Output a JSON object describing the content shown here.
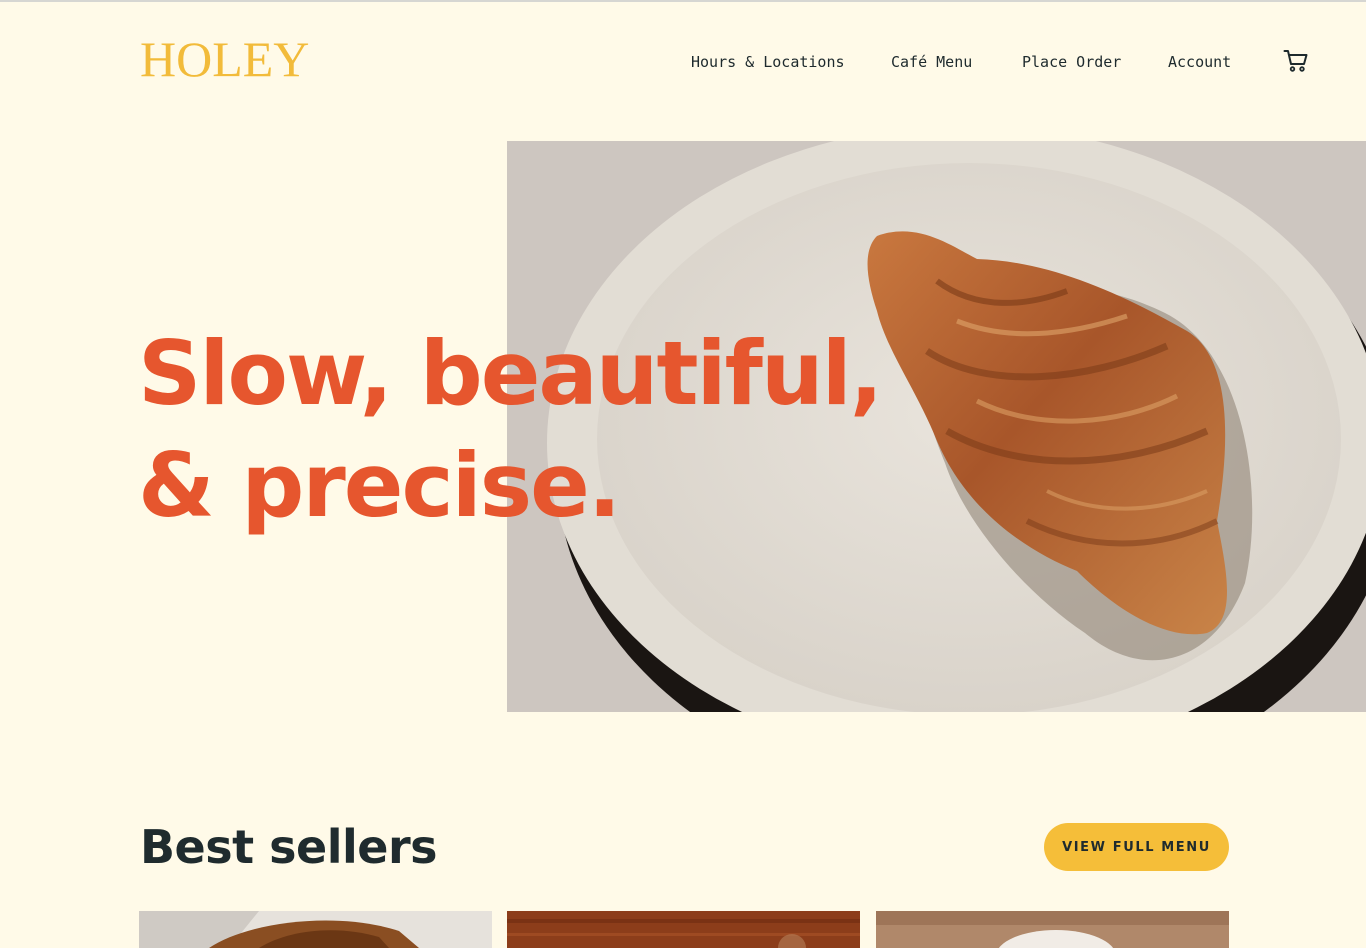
{
  "brand": {
    "logo": "HOLEY",
    "color": "#f2bb3a"
  },
  "nav": {
    "items": [
      {
        "label": "Hours & Locations"
      },
      {
        "label": "Café Menu"
      },
      {
        "label": "Place Order"
      },
      {
        "label": "Account"
      }
    ],
    "cart_icon": "cart-icon"
  },
  "hero": {
    "heading_line1": "Slow, beautiful,",
    "heading_line2": "& precise.",
    "heading_color": "#e6562e",
    "image": "croissant-on-plate-photo"
  },
  "best_sellers": {
    "title": "Best sellers",
    "button_label": "VIEW FULL MENU",
    "button_color": "#f5be39",
    "cards": [
      {
        "image": "bread-loaf-photo"
      },
      {
        "image": "wooden-table-photo"
      },
      {
        "image": "coffee-cup-photo"
      }
    ]
  }
}
